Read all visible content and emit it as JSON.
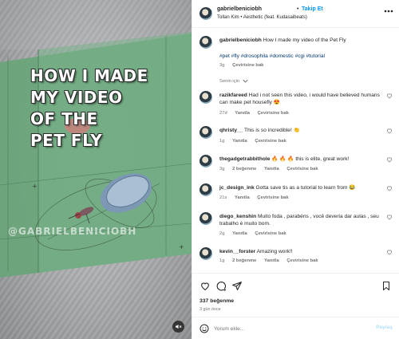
{
  "media": {
    "overlay_title_lines": [
      "HOW I MADE",
      "MY VIDEO",
      "OF THE",
      "PET FLY"
    ],
    "watermark": "@GABRIELBENICIOBH",
    "mute_icon": "speaker-muted-icon"
  },
  "header": {
    "username": "gabrielbeniciobh",
    "separator": "•",
    "follow_label": "Takip Et",
    "audio": "Tollan Kim • Aesthetic (feat. Kudasaibeats)",
    "more_icon": "more-horizontal-icon"
  },
  "caption": {
    "username": "gabrielbeniciobh",
    "text": "How I made my video of the Pet Fly",
    "hashtags": "#pet #fly #drosophila #domestic #cgi #tutorial",
    "time": "3g",
    "translate": "Çevirisine bak"
  },
  "hidden_comments_label": "Senin için",
  "comments": [
    {
      "username": "razikfareed",
      "text": "Had i not seen this video, i would have believed humans can make pet housefly 😍",
      "time": "27d",
      "reply": "Yanıtla",
      "translate": "Çevirisine bak"
    },
    {
      "username": "qhristy__",
      "text": "This is so incredible! 👏",
      "time": "1g",
      "reply": "Yanıtla",
      "translate": "Çevirisine bak"
    },
    {
      "username": "thegadgetrabbithole",
      "text": "🔥 🔥 🔥 this is elite, great work!",
      "time": "3g",
      "likes": "2 beğenme",
      "reply": "Yanıtla",
      "translate": "Çevirisine bak"
    },
    {
      "username": "jc_design_ink",
      "text": "Gotta save tis as a tutorial to learn from 😂",
      "time": "21s",
      "reply": "Yanıtla",
      "translate": "Çevirisine bak"
    },
    {
      "username": "diego_kenshin",
      "text": "Muito foda , parabéns , você deveria dar aulas , seu trabalho é muito bom.",
      "time": "2g",
      "reply": "Yanıtla",
      "translate": "Çevirisine bak"
    },
    {
      "username": "kevin__forster",
      "text": "Amazing work!!",
      "time": "1g",
      "likes": "2 beğenme",
      "reply": "Yanıtla",
      "translate": "Çevirisine bak"
    }
  ],
  "actions": {
    "like_icon": "heart-icon",
    "comment_icon": "comment-icon",
    "share_icon": "send-icon",
    "save_icon": "bookmark-icon"
  },
  "likes_count": "337 beğenme",
  "post_date": "3 gün önce",
  "add_comment": {
    "emoji_icon": "smile-icon",
    "placeholder": "Yorum ekle...",
    "post_label": "Paylaş"
  },
  "colors": {
    "accent": "#0095f6",
    "muted_text": "#737373",
    "hashtag": "#00376b",
    "green_plane": "#6aa57a"
  }
}
